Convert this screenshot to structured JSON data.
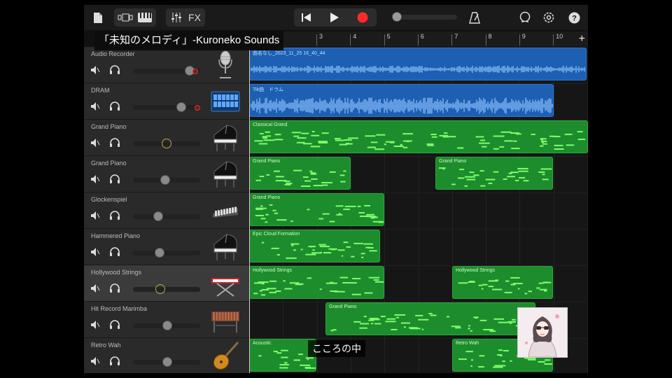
{
  "colors": {
    "audio": "#1c5fb3",
    "midi": "#1d8c2c",
    "record": "#ff2a2a",
    "accent": "#b9a640"
  },
  "toolbar": {
    "icons": [
      "document-icon",
      "tracks-view-icon",
      "keyboard-icon",
      "mixer-icon",
      "rewind-icon",
      "play-icon",
      "record-icon",
      "metronome-icon",
      "loop-icon",
      "settings-icon",
      "help-icon"
    ],
    "fx_label": "FX",
    "master_volume": 0.05
  },
  "overlay": {
    "title": "「未知のメロディ」-Kuroneko Sounds",
    "subtitle": "こころの中"
  },
  "ruler": {
    "bars": [
      "3",
      "4",
      "5",
      "6",
      "7",
      "8",
      "9",
      "10"
    ]
  },
  "tracks": [
    {
      "name": "Audio Recorder",
      "volume": 0.9,
      "instrument": "microphone-icon"
    },
    {
      "name": "DRAM",
      "volume": 0.76,
      "instrument": "drum-machine-icon"
    },
    {
      "name": "Grand Piano",
      "volume": 0.5,
      "instrument": "grand-piano-icon"
    },
    {
      "name": "Grand Piano",
      "volume": 0.48,
      "instrument": "grand-piano-icon"
    },
    {
      "name": "Glockenspiel",
      "volume": 0.35,
      "instrument": "glockenspiel-icon"
    },
    {
      "name": "Hammered Piano",
      "volume": 0.38,
      "instrument": "grand-piano-icon"
    },
    {
      "name": "Hollywood Strings",
      "volume": 0.39,
      "instrument": "keyboard-stand-icon"
    },
    {
      "name": "Hit Record Marimba",
      "volume": 0.51,
      "instrument": "marimba-icon"
    },
    {
      "name": "Retro Wah",
      "volume": 0.51,
      "instrument": "electric-guitar-icon"
    }
  ],
  "regions": [
    {
      "track": 0,
      "type": "audio",
      "label": "曲名なし_2023_11_25 16_40_44"
    },
    {
      "track": 1,
      "type": "audio",
      "label": "Tik曲　ドラム"
    },
    {
      "track": 2,
      "type": "midi",
      "label": "Classical Grand"
    },
    {
      "track": 3,
      "type": "midi",
      "label": "Grand Piano"
    },
    {
      "track": 3,
      "type": "midi",
      "label": "Grand Piano"
    },
    {
      "track": 4,
      "type": "midi",
      "label": "Grand Piano"
    },
    {
      "track": 5,
      "type": "midi",
      "label": "Epic Cloud Formation"
    },
    {
      "track": 6,
      "type": "midi",
      "label": "Hollywood Strings"
    },
    {
      "track": 6,
      "type": "midi",
      "label": "Hollywood Strings"
    },
    {
      "track": 7,
      "type": "midi",
      "label": "Grand Piano"
    },
    {
      "track": 8,
      "type": "midi",
      "label": "Acoustic"
    },
    {
      "track": 8,
      "type": "midi",
      "label": "Retro Wah"
    }
  ]
}
